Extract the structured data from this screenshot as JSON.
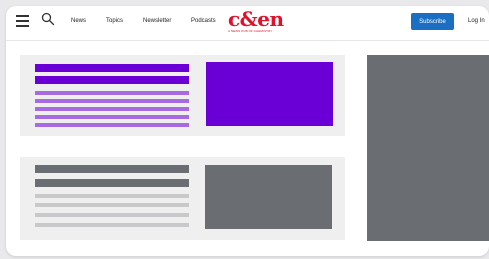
{
  "header": {
    "nav": [
      "News",
      "Topics",
      "Newsletter",
      "Podcasts"
    ],
    "logo": {
      "wordmark": "c&en",
      "tagline": "A NEWS PUB OF CHEMISTRY"
    },
    "subscribe_label": "Subscribe",
    "login_label": "Log In"
  },
  "icons": {
    "menu": "hamburger-menu-icon",
    "search": "magnifier-icon"
  },
  "colors": {
    "accent_purple": "#6a00d6",
    "accent_purple_light": "#a66be0",
    "placeholder_gray": "#6a6d72",
    "placeholder_gray_light": "#c9c9cc",
    "brand_red": "#e0112b",
    "subscribe_blue": "#1a6fc2"
  }
}
